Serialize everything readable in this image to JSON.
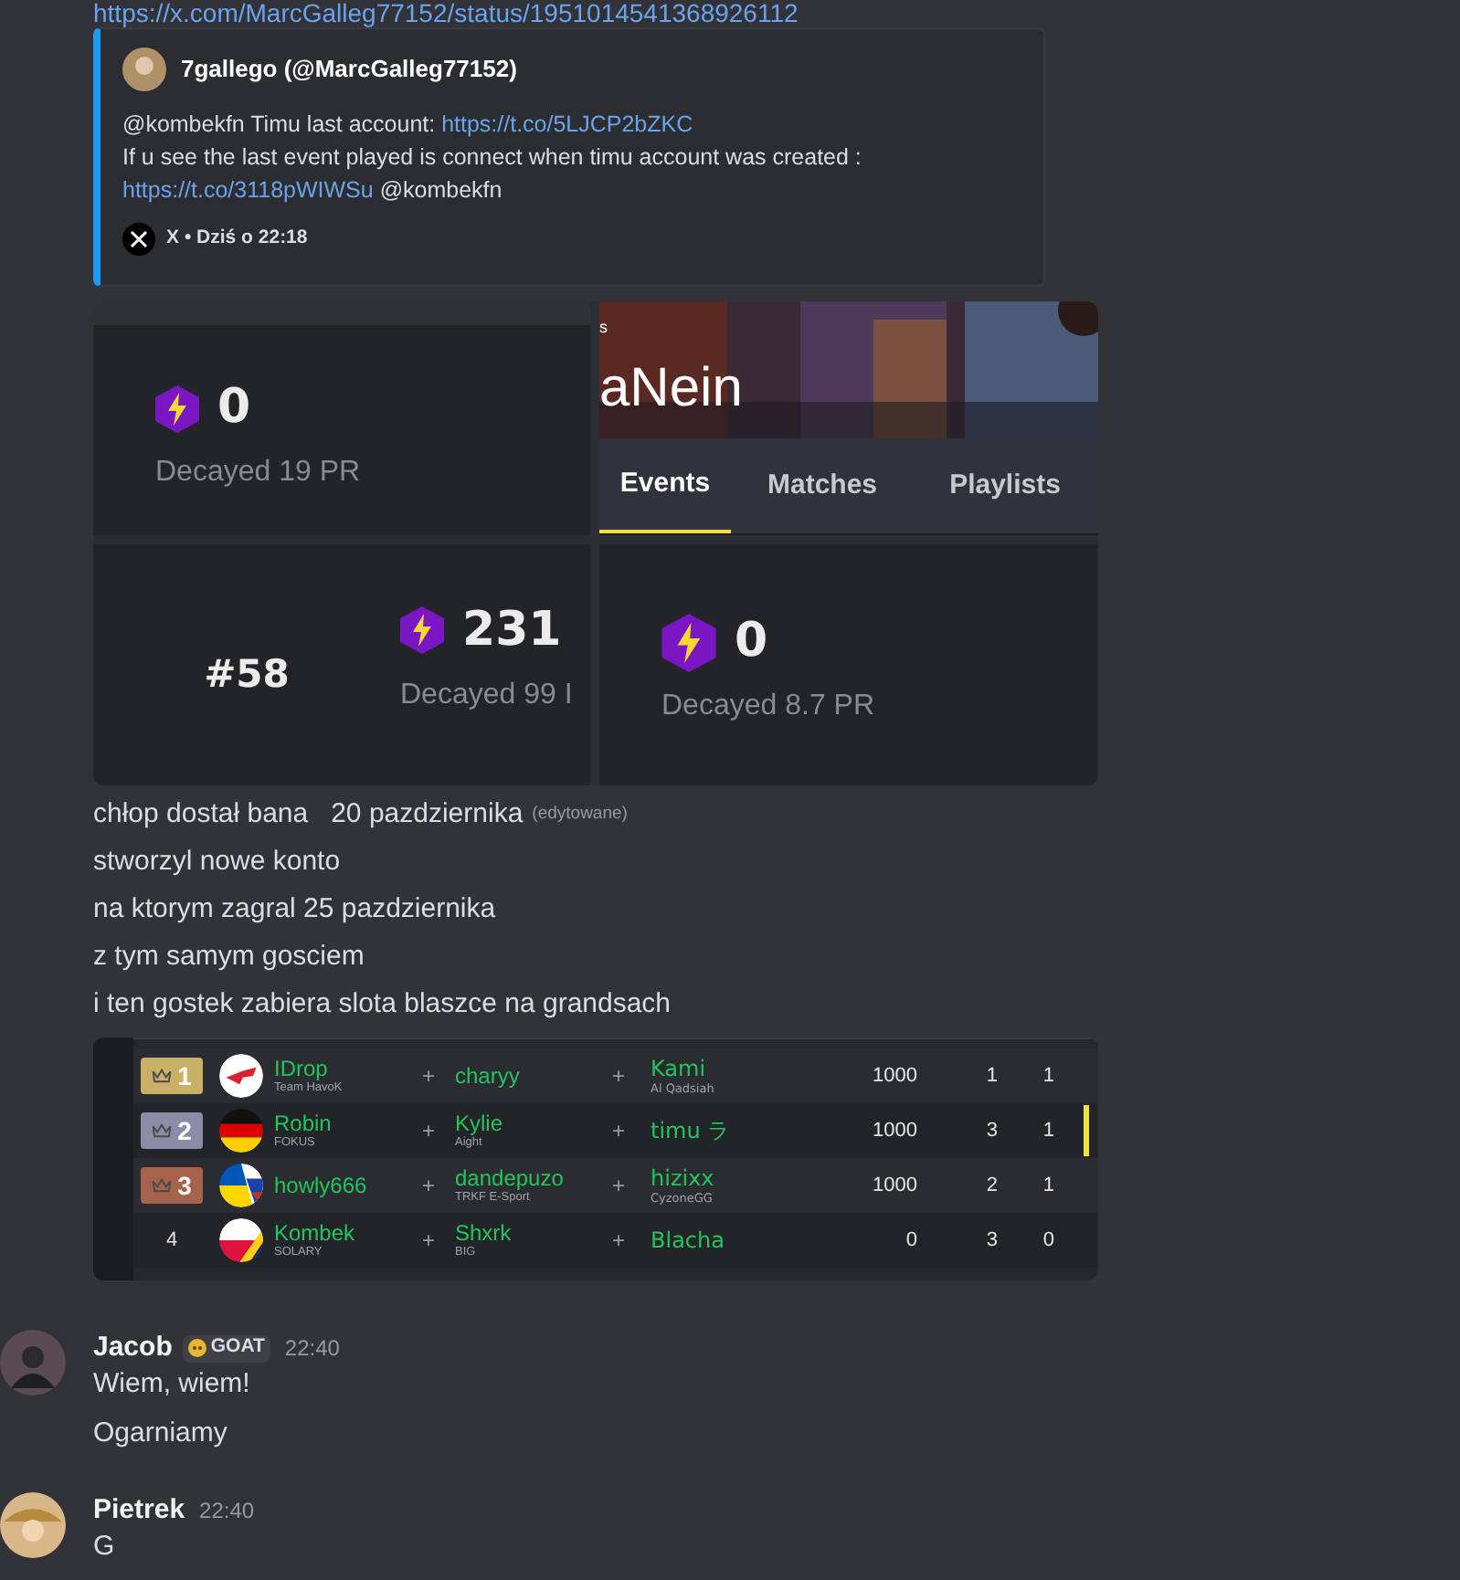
{
  "top_link": "https://x.com/MarcGalleg77152/status/1951014541368926112",
  "embed": {
    "author": "7gallego (@MarcGalleg77152)",
    "lines": [
      [
        {
          "kind": "text",
          "text": "@kombekfn Timu last account: "
        },
        {
          "kind": "link",
          "text": "https://t.co/5LJCP2bZKC"
        }
      ],
      [
        {
          "kind": "text",
          "text": "If u see the last event played is connect when timu account was created :"
        }
      ],
      [
        {
          "kind": "link",
          "text": "https://t.co/3118pWIWSu"
        },
        {
          "kind": "text",
          "text": " @kombekfn"
        }
      ]
    ],
    "source": "X",
    "separator": "•",
    "time": "Dziś o 22:18"
  },
  "stats": {
    "top_card": {
      "value": "0",
      "sub": "Decayed 19 PR"
    },
    "banner": {
      "small": "s",
      "name": "aNein"
    },
    "tabs": [
      {
        "label": "Events",
        "selected": true
      },
      {
        "label": "Matches",
        "selected": false
      },
      {
        "label": "Playlists",
        "selected": false
      }
    ],
    "rank_card": {
      "rank": "#58",
      "value": "231",
      "sub": "Decayed 99 I"
    },
    "right_card": {
      "value": "0",
      "sub": "Decayed 8.7 PR"
    }
  },
  "message_lines": [
    {
      "text": "chłop dostał bana   20 pazdziernika",
      "edited": "(edytowane)"
    },
    {
      "text": "stworzyl nowe konto"
    },
    {
      "text": "na ktorym zagral 25 pazdziernika"
    },
    {
      "text": "z tym samym gosciem"
    },
    {
      "text": "i ten gostek zabiera slota blaszce na grandsach"
    }
  ],
  "leaderboard": [
    {
      "place": "1",
      "kind": "medal",
      "color": "#c8b066",
      "flag": {
        "kind": "poland-mark"
      },
      "selected": false,
      "players": [
        {
          "name": "IDrop",
          "team": "Team HavoK"
        },
        {
          "name": "charyy"
        },
        {
          "name": "Kami",
          "team": "Al Qadsiah"
        }
      ],
      "points": "1000",
      "column_2": "1",
      "column_3": "1"
    },
    {
      "place": "2",
      "kind": "medal",
      "color": "#8c8ca6",
      "flag": {
        "kind": "germany"
      },
      "selected": true,
      "players": [
        {
          "name": "Robin",
          "team": "FOKUS"
        },
        {
          "name": "Kylie",
          "team": "Aight"
        },
        {
          "name": "timu ラ"
        }
      ],
      "points": "1000",
      "column_2": "3",
      "column_3": "1"
    },
    {
      "place": "3",
      "kind": "medal",
      "color": "#a6624a",
      "flag": {
        "kind": "ukraine-russia"
      },
      "selected": false,
      "players": [
        {
          "name": "howly666"
        },
        {
          "name": "dandepuzo",
          "team": "TRKF E-Sport"
        },
        {
          "name": "hizixx",
          "team": "CyzoneGG"
        }
      ],
      "points": "1000",
      "column_2": "2",
      "column_3": "1"
    },
    {
      "place": "4",
      "kind": "plain",
      "flag": {
        "kind": "poland-romania"
      },
      "selected": false,
      "players": [
        {
          "name": "Kombek",
          "team": "SOLARY"
        },
        {
          "name": "Shxrk",
          "team": "BIG"
        },
        {
          "name": "Blacha"
        }
      ],
      "points": "0",
      "column_2": "3",
      "column_3": "0"
    }
  ],
  "plus_sign": "+",
  "messages": [
    {
      "author": "Jacob",
      "role": "GOAT",
      "time": "22:40",
      "lines": [
        "Wiem, wiem!",
        "Ogarniamy"
      ]
    },
    {
      "author": "Pietrek",
      "time": "22:40",
      "lines": [
        "G"
      ]
    }
  ]
}
